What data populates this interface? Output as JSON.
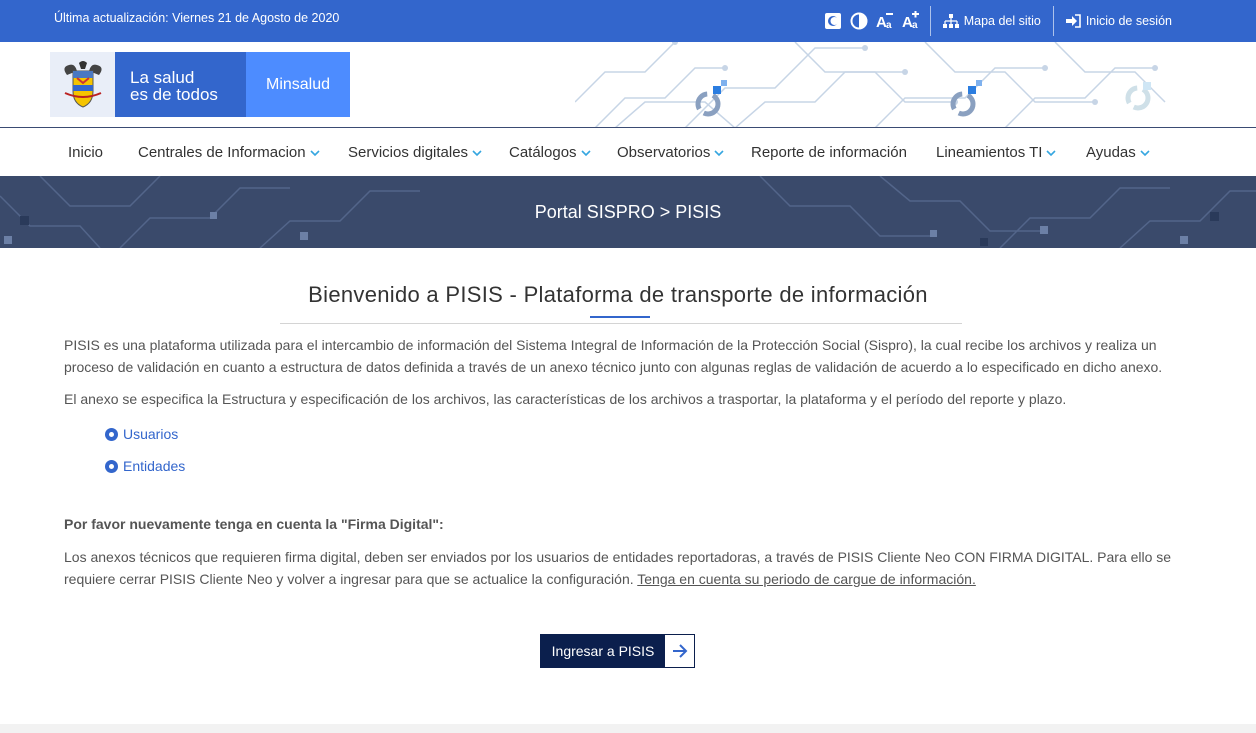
{
  "topbar": {
    "last_update": "Última actualización: Viernes 21 de Agosto de 2020",
    "tools": [
      "contrast-toggle-icon",
      "high-contrast-icon",
      "decrease-font-icon",
      "increase-font-icon"
    ],
    "sitemap": "Mapa del sitio",
    "login": "Inicio de sesión"
  },
  "header": {
    "slogan_line1": "La salud",
    "slogan_line2": "es de todos",
    "brand": "Minsalud"
  },
  "nav": {
    "items": [
      {
        "label": "Inicio",
        "dropdown": false
      },
      {
        "label": "Centrales de Informacion",
        "dropdown": true
      },
      {
        "label": "Servicios digitales",
        "dropdown": true
      },
      {
        "label": "Catálogos",
        "dropdown": true
      },
      {
        "label": "Observatorios",
        "dropdown": true
      },
      {
        "label": "Reporte de información",
        "dropdown": false
      },
      {
        "label": "Lineamientos TI",
        "dropdown": true
      },
      {
        "label": "Ayudas",
        "dropdown": true
      }
    ]
  },
  "banner": {
    "breadcrumb": "Portal SISPRO > PISIS"
  },
  "main": {
    "title": "Bienvenido a PISIS - Plataforma de transporte de información",
    "intro": "PISIS es una plataforma utilizada para el intercambio de información del Sistema Integral de Información de la Protección Social (Sispro), la cual recibe los archivos y realiza un proceso de validación en cuanto a estructura de datos definida a través de un anexo técnico junto con algunas reglas de validación de acuerdo a lo especificado en dicho anexo.",
    "annex": "El anexo se especifica la Estructura y especificación de los archivos, las características de los archivos a trasportar, la plataforma y el período del reporte y plazo.",
    "links": [
      "Usuarios",
      "Entidades"
    ],
    "notice_title": "Por favor nuevamente tenga en cuenta la \"Firma Digital\":",
    "notice_text": "Los anexos técnicos que requieren firma digital, deben ser enviados por los usuarios de entidades reportadoras, a través de PISIS Cliente Neo CON FIRMA DIGITAL. Para ello se requiere cerrar PISIS Cliente Neo y volver a ingresar para que se actualice la configuración.",
    "notice_link": "Tenga en cuenta su periodo de cargue de información.",
    "cta_label": "Ingresar a PISIS"
  },
  "colors": {
    "primary": "#3366cc",
    "brand_light": "#4d8cff",
    "banner": "#3a4a6b",
    "cta": "#0b1f4d"
  }
}
